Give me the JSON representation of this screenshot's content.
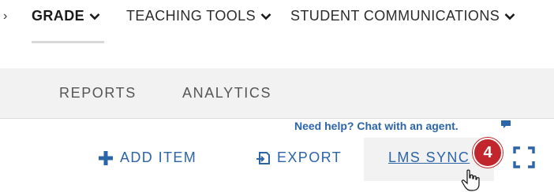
{
  "nav": {
    "partial_chevron": "›",
    "items": [
      {
        "label": "GRADE",
        "active": true
      },
      {
        "label": "TEACHING TOOLS",
        "active": false
      },
      {
        "label": "STUDENT COMMUNICATIONS",
        "active": false
      }
    ]
  },
  "subnav": {
    "tabs": [
      {
        "label": "REPORTS"
      },
      {
        "label": "ANALYTICS"
      }
    ]
  },
  "help": {
    "label": "Need help? Chat with an agent."
  },
  "toolbar": {
    "add_item": "ADD ITEM",
    "export": "EXPORT",
    "lms_sync": "LMS SYNC",
    "badge_count": "4"
  },
  "colors": {
    "link": "#2c64a8",
    "badge": "#c0262c",
    "band": "#f2f2f2"
  },
  "icons": [
    "chevron-down-icon",
    "plus-icon",
    "export-icon",
    "chat-bubble-icon",
    "expand-icon",
    "hand-cursor-icon"
  ]
}
